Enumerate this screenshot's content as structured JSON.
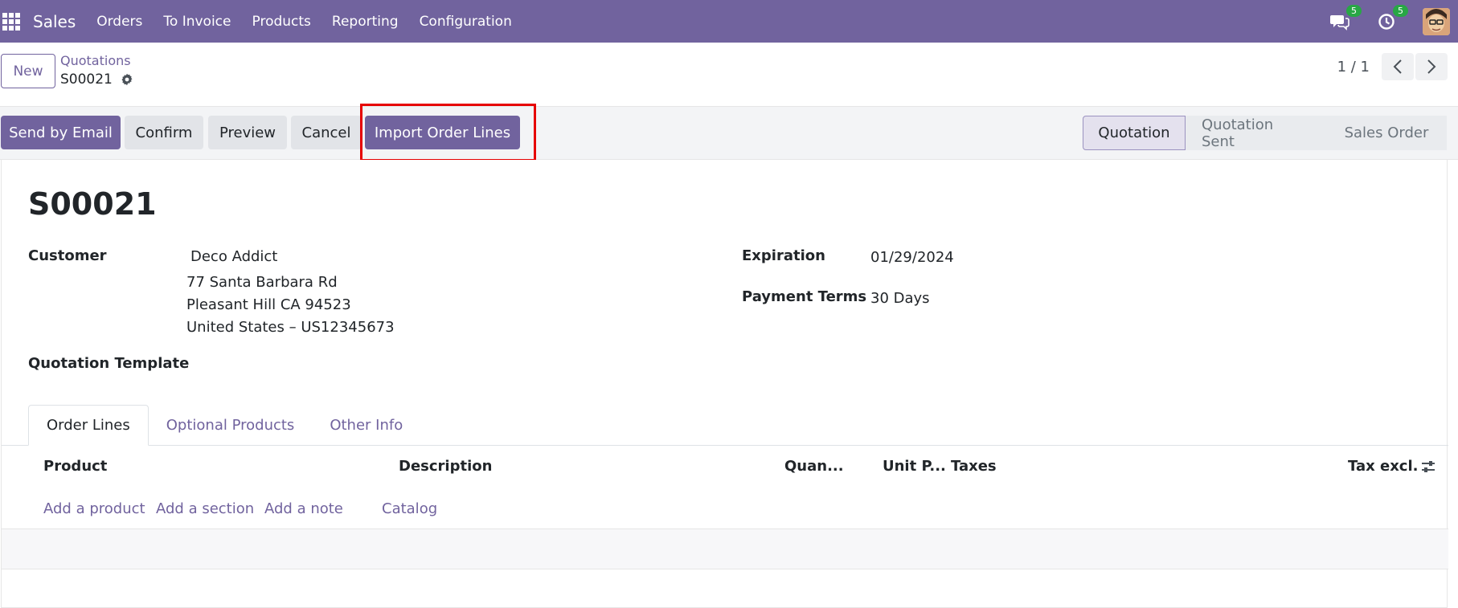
{
  "navbar": {
    "app": "Sales",
    "menu": [
      "Orders",
      "To Invoice",
      "Products",
      "Reporting",
      "Configuration"
    ],
    "messages_badge": "5",
    "activities_badge": "5"
  },
  "control": {
    "new_label": "New",
    "breadcrumb_parent": "Quotations",
    "breadcrumb_current": "S00021",
    "pager": "1 / 1"
  },
  "actions": {
    "send_email": "Send by Email",
    "confirm": "Confirm",
    "preview": "Preview",
    "cancel": "Cancel",
    "import_lines": "Import Order Lines"
  },
  "statusbar": [
    "Quotation",
    "Quotation Sent",
    "Sales Order"
  ],
  "form": {
    "name": "S00021",
    "customer_label": "Customer",
    "customer_name": "Deco Addict",
    "address_line1": "77 Santa Barbara Rd",
    "address_line2": "Pleasant Hill CA 94523",
    "address_line3": "United States – US12345673",
    "template_label": "Quotation Template",
    "expiration_label": "Expiration",
    "expiration_value": "01/29/2024",
    "payment_terms_label": "Payment Terms",
    "payment_terms_value": "30 Days"
  },
  "tabs": [
    "Order Lines",
    "Optional Products",
    "Other Info"
  ],
  "table": {
    "headers": [
      "Product",
      "Description",
      "Quan...",
      "Unit P...",
      "Taxes",
      "Tax excl."
    ],
    "add_product": "Add a product",
    "add_section": "Add a section",
    "add_note": "Add a note",
    "catalog": "Catalog"
  },
  "colors": {
    "brand": "#71639e",
    "highlight": "#e60000",
    "badge": "#28a745"
  }
}
